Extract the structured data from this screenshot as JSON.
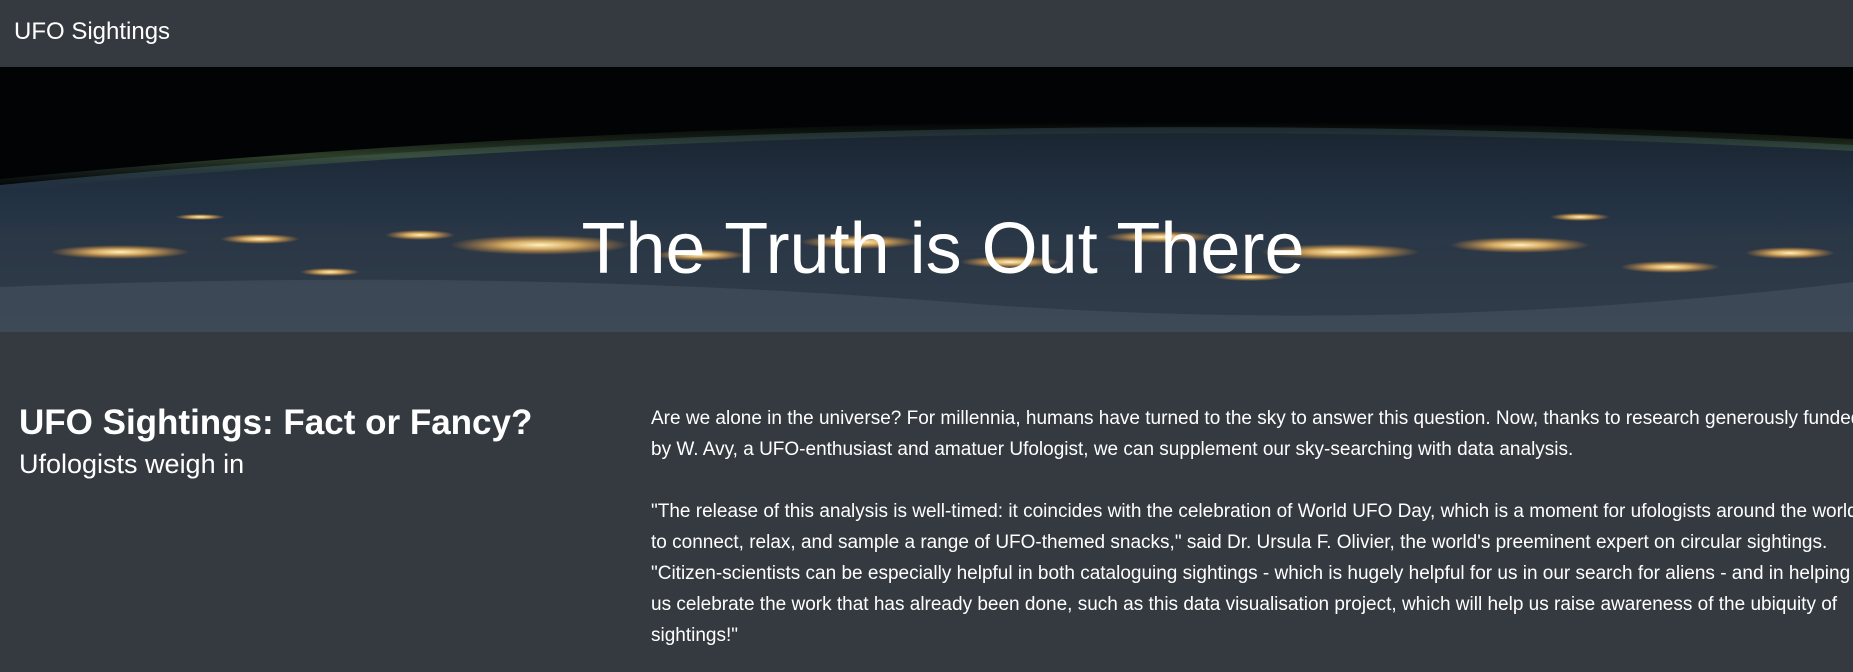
{
  "navbar": {
    "brand": "UFO Sightings"
  },
  "hero": {
    "title": "The Truth is Out There"
  },
  "article": {
    "title": "UFO Sightings: Fact or Fancy?",
    "subtitle": "Ufologists weigh in",
    "paragraphs": [
      "Are we alone in the universe? For millennia, humans have turned to the sky to answer this question. Now, thanks to research generously funded by W. Avy, a UFO-enthusiast and amatuer Ufologist, we can supplement our sky-searching with data analysis.",
      "\"The release of this analysis is well-timed: it coincides with the celebration of World UFO Day, which is a moment for ufologists around the world to connect, relax, and sample a range of UFO-themed snacks,\" said Dr. Ursula F. Olivier, the world's preeminent expert on circular sightings. \"Citizen-scientists can be especially helpful in both cataloguing sightings - which is hugely helpful for us in our search for aliens - and in helping us celebrate the work that has already been done, such as this data visualisation project, which will help us raise awareness of the ubiquity of sightings!\""
    ]
  },
  "colors": {
    "background": "#343a40",
    "text": "#ffffff",
    "hero_sky": "#000000",
    "city_lights": "#ffd27a"
  }
}
